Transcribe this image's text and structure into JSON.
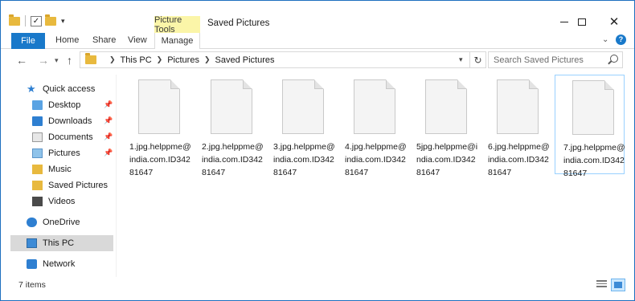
{
  "window": {
    "title": "Saved Pictures",
    "context_tab": "Picture Tools",
    "controls": {
      "minimize": "minimize",
      "maximize": "maximize",
      "close": "✕"
    }
  },
  "ribbon": {
    "tabs": [
      "File",
      "Home",
      "Share",
      "View",
      "Manage"
    ],
    "collapse_glyph": "⌄",
    "help_glyph": "?"
  },
  "address": {
    "crumbs": [
      "This PC",
      "Pictures",
      "Saved Pictures"
    ],
    "search_placeholder": "Search Saved Pictures"
  },
  "navigation": {
    "quick_access": "Quick access",
    "items": [
      {
        "label": "Desktop",
        "icon": "desktop-folder-icon",
        "pinned": true
      },
      {
        "label": "Downloads",
        "icon": "downloads-folder-icon",
        "pinned": true
      },
      {
        "label": "Documents",
        "icon": "documents-folder-icon",
        "pinned": true
      },
      {
        "label": "Pictures",
        "icon": "pictures-folder-icon",
        "pinned": true
      },
      {
        "label": "Music",
        "icon": "music-folder-icon",
        "pinned": false
      },
      {
        "label": "Saved Pictures",
        "icon": "folder-icon",
        "pinned": false
      },
      {
        "label": "Videos",
        "icon": "videos-folder-icon",
        "pinned": false
      }
    ],
    "onedrive": "OneDrive",
    "this_pc": "This PC",
    "network": "Network"
  },
  "files": [
    {
      "name": "1.jpg.helppme@india.com.ID34281647"
    },
    {
      "name": "2.jpg.helppme@india.com.ID34281647"
    },
    {
      "name": "3.jpg.helppme@india.com.ID34281647"
    },
    {
      "name": "4.jpg.helppme@india.com.ID34281647"
    },
    {
      "name": "5jpg.helppme@india.com.ID34281647"
    },
    {
      "name": "6.jpg.helppme@india.com.ID34281647"
    },
    {
      "name": "7.jpg.helppme@india.com.ID34281647",
      "selected": true
    }
  ],
  "status": {
    "item_count": "7 items"
  },
  "colors": {
    "accent": "#1979ca",
    "context_tab": "#fbf5a8",
    "selection": "#d9d9d9",
    "file_selection_border": "#99d1ff"
  }
}
